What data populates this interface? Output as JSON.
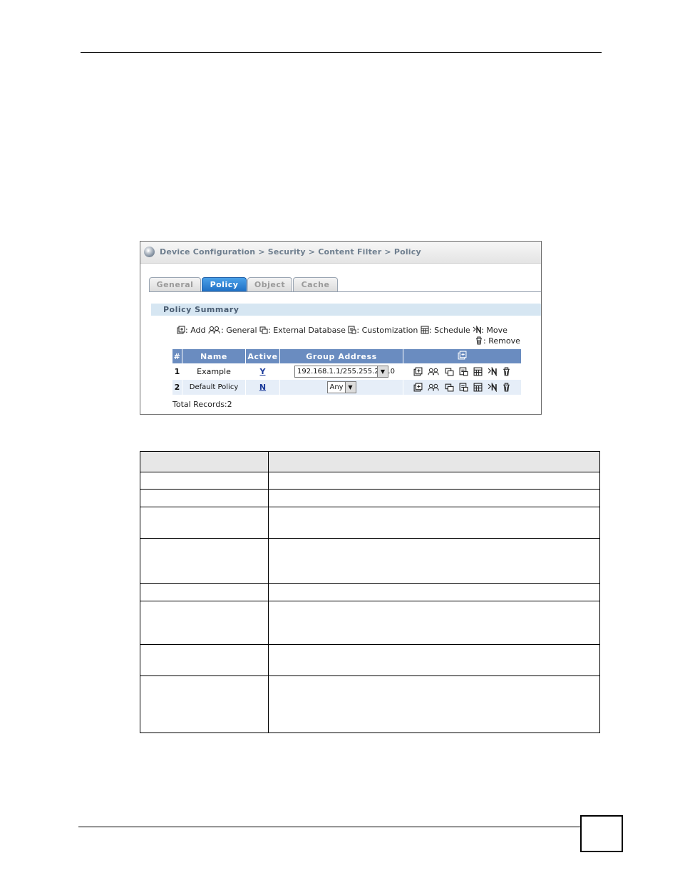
{
  "breadcrumb": "Device Configuration > Security > Content Filter > Policy",
  "tabs": [
    {
      "label": "General",
      "active": false
    },
    {
      "label": "Policy",
      "active": true
    },
    {
      "label": "Object",
      "active": false
    },
    {
      "label": "Cache",
      "active": false
    }
  ],
  "section_title": "Policy Summary",
  "legend": {
    "add": ": Add",
    "general": ": General",
    "external_database": ": External Database",
    "customization": ": Customization",
    "schedule": ": Schedule",
    "move": ": Move",
    "remove": ": Remove"
  },
  "table": {
    "headers": [
      "#",
      "Name",
      "Active",
      "Group Address"
    ],
    "rows": [
      {
        "num": "1",
        "name": "Example",
        "active": "Y",
        "group_address": "192.168.1.1/255.255.255.0"
      },
      {
        "num": "2",
        "name": "Default Policy",
        "active": "N",
        "group_address": "Any"
      }
    ]
  },
  "total_records": "Total Records:2",
  "colors": {
    "header_blue": "#6a8cc0",
    "active_tab": "#1f6fc4",
    "section_bar": "#d6e6f2"
  }
}
